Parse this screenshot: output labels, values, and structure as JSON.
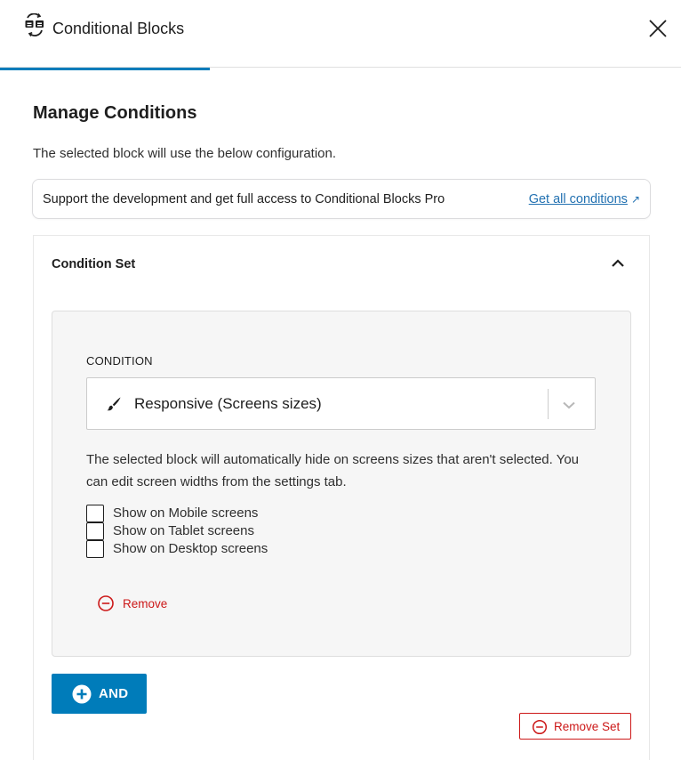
{
  "header": {
    "title": "Conditional Blocks",
    "icon": "conditional-blocks-logo-icon",
    "close_icon": "close-icon"
  },
  "main": {
    "title": "Manage Conditions",
    "description": "The selected block will use the below configuration."
  },
  "notice": {
    "text": "Support the development and get full access to Conditional Blocks Pro",
    "link_label": "Get all conditions",
    "link_icon": "external-link-icon"
  },
  "condition_set": {
    "title": "Condition Set",
    "toggle_icon": "chevron-up-icon",
    "condition": {
      "label": "CONDITION",
      "selected_value": "Responsive (Screens sizes)",
      "select_icon": "paintbrush-icon",
      "help_text": "The selected block will automatically hide on screens sizes that aren't selected. You can edit screen widths from the settings tab.",
      "options": [
        {
          "label": "Show on Mobile screens",
          "checked": false
        },
        {
          "label": "Show on Tablet screens",
          "checked": false
        },
        {
          "label": "Show on Desktop screens",
          "checked": false
        }
      ],
      "remove_label": "Remove"
    },
    "and_label": "AND",
    "remove_set_label": "Remove Set"
  },
  "colors": {
    "accent": "#007cba",
    "link": "#2271b1",
    "danger": "#cc1818"
  }
}
